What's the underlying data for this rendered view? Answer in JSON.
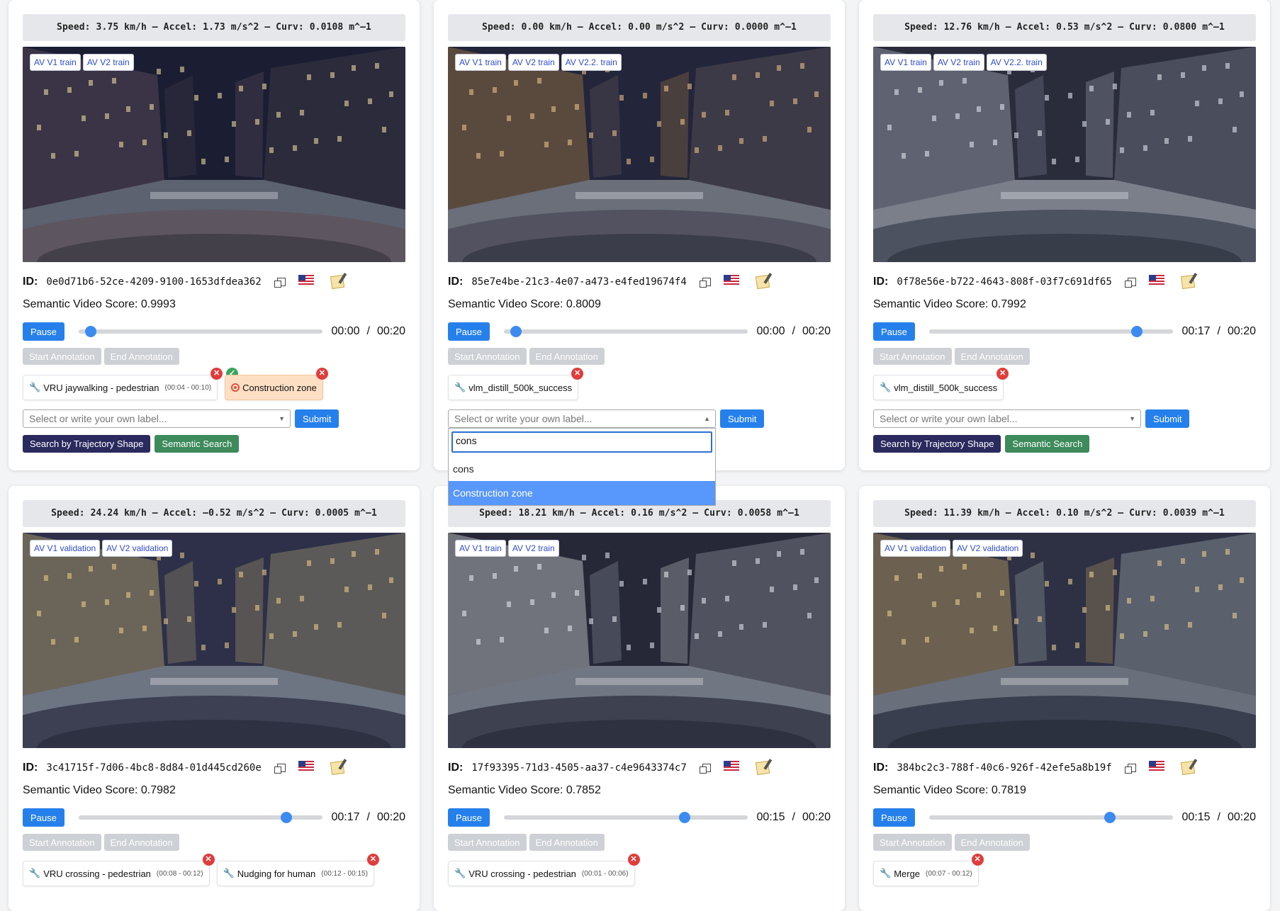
{
  "cards": [
    {
      "telemetry": "Speed: 3.75 km/h – Accel:  1.73 m/s^2 – Curv: 0.0108 m^–1",
      "chips": [
        "AV V1 train",
        "AV V2 train"
      ],
      "id_label": "ID:",
      "id": "0e0d71b6-52ce-4209-9100-1653dfdea362",
      "score_text": "Semantic Video Score: 0.9993",
      "pause_label": "Pause",
      "progress": 0.05,
      "time_current": "00:00",
      "time_sep": "/",
      "time_total": "00:20",
      "start_label": "Start Annotation",
      "end_label": "End Annotation",
      "tags": [
        {
          "label": "VRU jaywalking - pedestrian",
          "time": "(00:04 - 00:10)",
          "style": "plain",
          "icon": "wrench-icon",
          "confirmed": true
        },
        {
          "label": "Construction zone",
          "time": "",
          "style": "orange",
          "icon": "target-icon",
          "confirmed": false
        }
      ],
      "select_placeholder": "Select or write your own label...",
      "submit_label": "Submit",
      "traj_label": "Search by Trajectory Shape",
      "semantic_label": "Semantic Search",
      "scene": "night-city"
    },
    {
      "telemetry": "Speed: 0.00 km/h – Accel:  0.00 m/s^2 – Curv: 0.0000 m^–1",
      "chips": [
        "AV V1 train",
        "AV V2 train",
        "AV V2.2. train"
      ],
      "id_label": "ID:",
      "id": "85e7e4be-21c3-4e07-a473-e4fed19674f4",
      "score_text": "Semantic Video Score: 0.8009",
      "pause_label": "Pause",
      "progress": 0.05,
      "time_current": "00:00",
      "time_sep": "/",
      "time_total": "00:20",
      "start_label": "Start Annotation",
      "end_label": "End Annotation",
      "tags": [
        {
          "label": "vlm_distill_500k_success",
          "time": "",
          "style": "plain",
          "icon": "wrench-icon",
          "confirmed": false
        }
      ],
      "select_placeholder": "Select or write your own label...",
      "submit_label": "Submit",
      "dropdown": {
        "query": "cons",
        "options": [
          "cons",
          "Construction zone"
        ],
        "highlighted": 1
      },
      "scene": "intersection"
    },
    {
      "telemetry": "Speed: 12.76 km/h – Accel:  0.53 m/s^2 – Curv: 0.0800 m^–1",
      "chips": [
        "AV V1 train",
        "AV V2 train",
        "AV V2.2. train"
      ],
      "id_label": "ID:",
      "id": "0f78e56e-b722-4643-808f-03f7c691df65",
      "score_text": "Semantic Video Score: 0.7992",
      "pause_label": "Pause",
      "progress": 0.85,
      "time_current": "00:17",
      "time_sep": "/",
      "time_total": "00:20",
      "start_label": "Start Annotation",
      "end_label": "End Annotation",
      "tags": [
        {
          "label": "vlm_distill_500k_success",
          "time": "",
          "style": "plain",
          "icon": "wrench-icon",
          "confirmed": false
        }
      ],
      "select_placeholder": "Select or write your own label...",
      "submit_label": "Submit",
      "traj_label": "Search by Trajectory Shape",
      "semantic_label": "Semantic Search",
      "scene": "blurred-cars"
    },
    {
      "telemetry": "Speed: 24.24 km/h – Accel: –0.52 m/s^2 – Curv: 0.0005 m^–1",
      "chips": [
        "AV V1 validation",
        "AV V2 validation"
      ],
      "id_label": "ID:",
      "id": "3c41715f-7d06-4bc8-8d84-01d445cd260e",
      "score_text": "Semantic Video Score: 0.7982",
      "pause_label": "Pause",
      "progress": 0.85,
      "time_current": "00:17",
      "time_sep": "/",
      "time_total": "00:20",
      "start_label": "Start Annotation",
      "end_label": "End Annotation",
      "tags": [
        {
          "label": "VRU crossing - pedestrian",
          "time": "(00:08 - 00:12)",
          "style": "plain",
          "icon": "wrench-icon",
          "confirmed": false
        },
        {
          "label": "Nudging for human",
          "time": "(00:12 - 00:15)",
          "style": "plain",
          "icon": "wrench-icon",
          "confirmed": false
        }
      ],
      "scene": "residential"
    },
    {
      "telemetry": "Speed: 18.21 km/h – Accel:  0.16 m/s^2 – Curv: 0.0058 m^–1",
      "chips": [
        "AV V1 train",
        "AV V2 train"
      ],
      "id_label": "ID:",
      "id": "17f93395-71d3-4505-aa37-c4e9643374c7",
      "score_text": "Semantic Video Score: 0.7852",
      "pause_label": "Pause",
      "progress": 0.74,
      "time_current": "00:15",
      "time_sep": "/",
      "time_total": "00:20",
      "start_label": "Start Annotation",
      "end_label": "End Annotation",
      "tags": [
        {
          "label": "VRU crossing - pedestrian",
          "time": "(00:01 - 00:06)",
          "style": "plain",
          "icon": "wrench-icon",
          "confirmed": false
        }
      ],
      "scene": "police"
    },
    {
      "telemetry": "Speed: 11.39 km/h – Accel:  0.10 m/s^2 – Curv: 0.0039 m^–1",
      "chips": [
        "AV V1 validation",
        "AV V2 validation"
      ],
      "id_label": "ID:",
      "id": "384bc2c3-788f-40c6-926f-42efe5a8b19f",
      "score_text": "Semantic Video Score: 0.7819",
      "pause_label": "Pause",
      "progress": 0.74,
      "time_current": "00:15",
      "time_sep": "/",
      "time_total": "00:20",
      "start_label": "Start Annotation",
      "end_label": "End Annotation",
      "tags": [
        {
          "label": "Merge",
          "time": "(00:07 - 00:12)",
          "style": "plain",
          "icon": "wrench-icon",
          "confirmed": false
        }
      ],
      "scene": "towers"
    }
  ]
}
